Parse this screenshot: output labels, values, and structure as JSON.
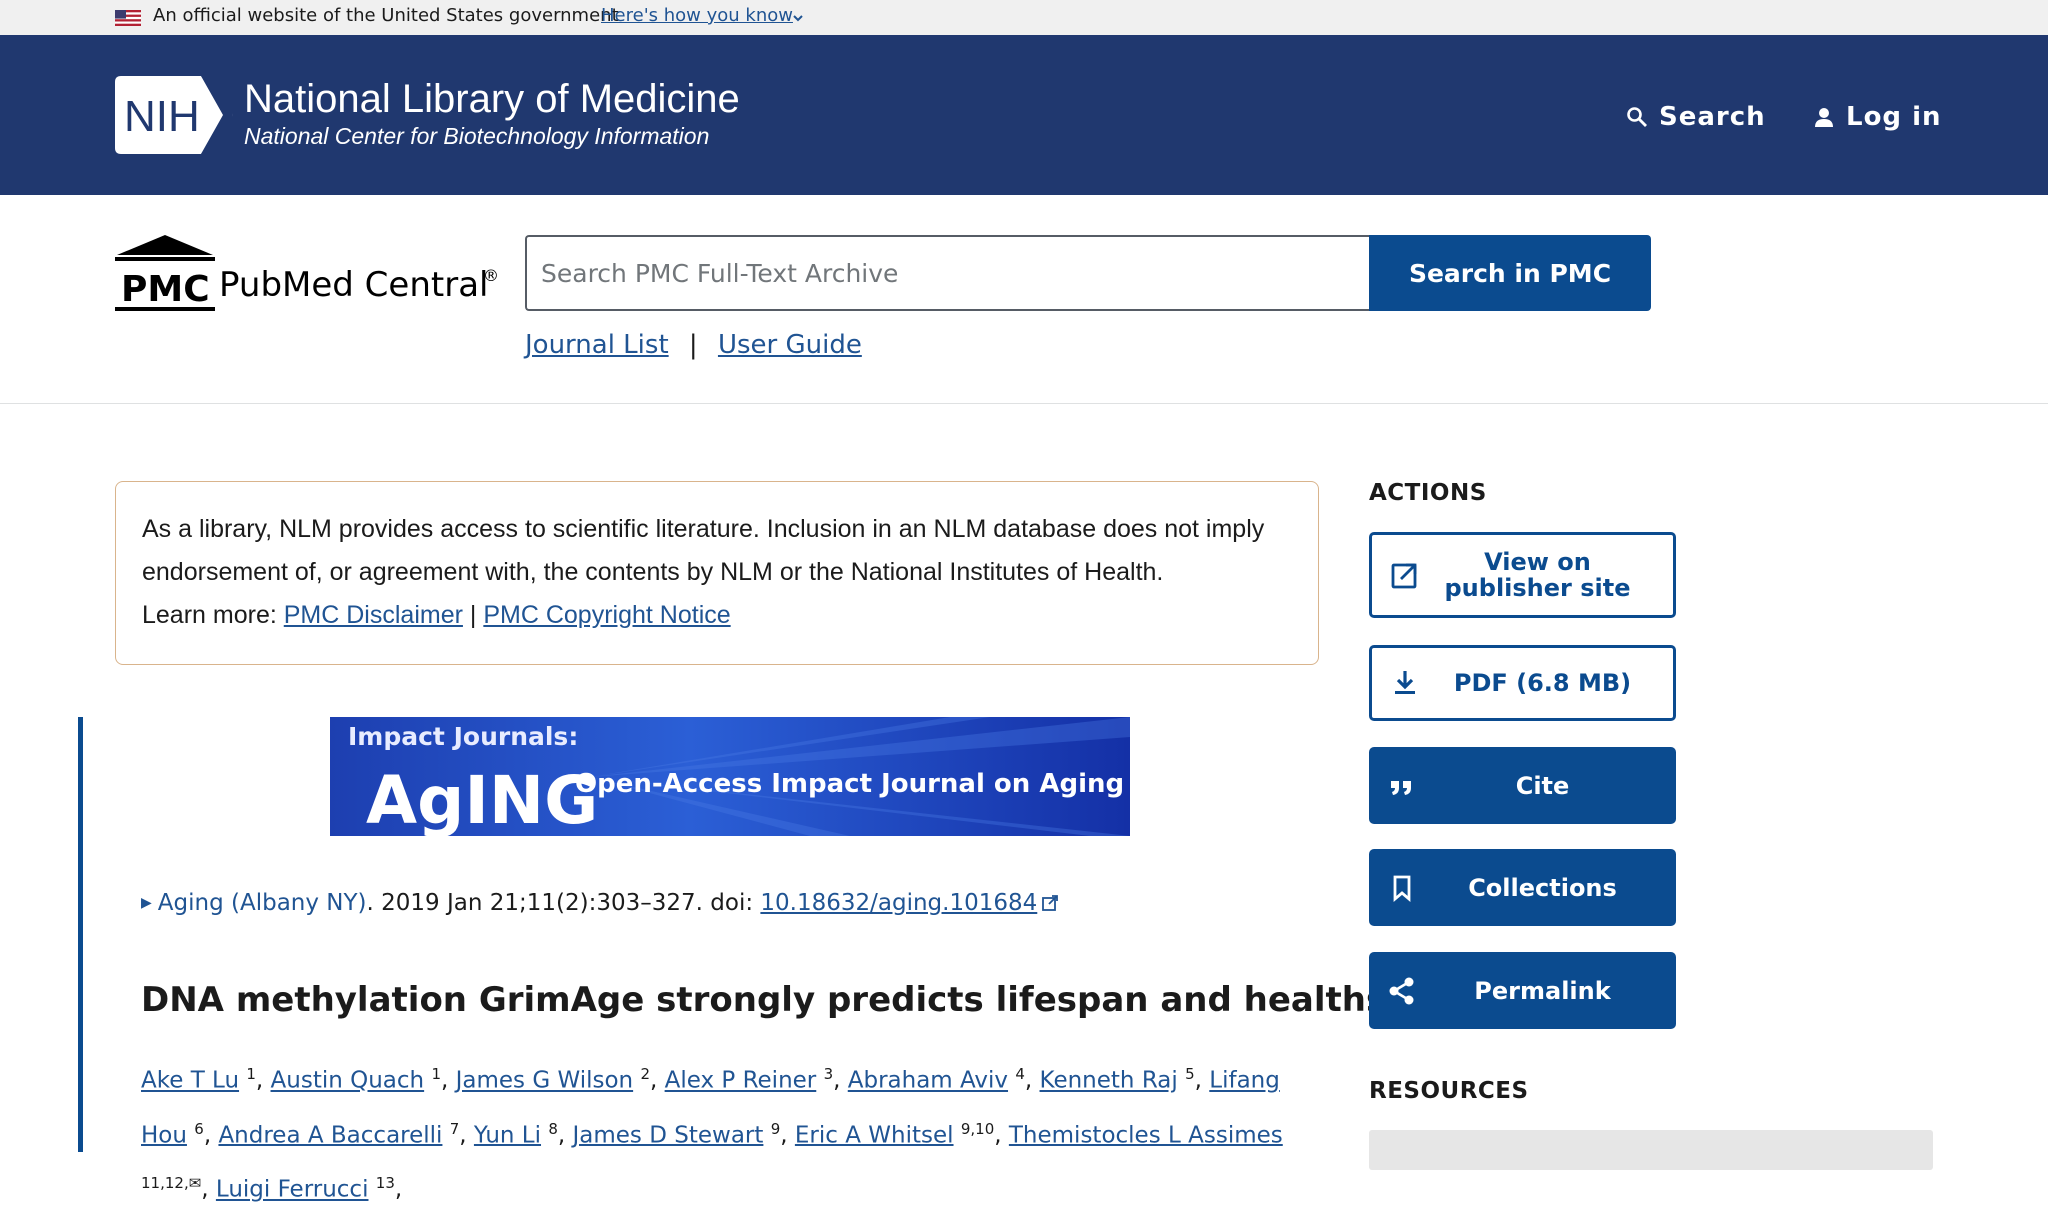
{
  "gov_banner": {
    "text": "An official website of the United States government",
    "link": "Here's how you know"
  },
  "header": {
    "logo_text": "NIH",
    "title": "National Library of Medicine",
    "subtitle": "National Center for Biotechnology Information",
    "search_label": "Search",
    "login_label": "Log in",
    "bg_color": "#20386f"
  },
  "pmc": {
    "logo_mark": "PMC",
    "logo_text": "PubMed Central",
    "logo_reg": "®",
    "search_placeholder": "Search PMC Full-Text Archive",
    "search_button": "Search in PMC",
    "links": [
      "Journal List",
      "User Guide"
    ],
    "link_separator": "|"
  },
  "disclaimer": {
    "text": "As a library, NLM provides access to scientific literature. Inclusion in an NLM database does not imply endorsement of, or agreement with, the contents by NLM or the National Institutes of Health.",
    "learn_more": "Learn more:",
    "link1": "PMC Disclaimer",
    "sep": "|",
    "link2": "PMC Copyright Notice"
  },
  "article": {
    "banner": {
      "publisher": "Impact Journals:",
      "journal_logo": "AgING",
      "tagline": "Open-Access Impact Journal on Aging"
    },
    "journal": "Aging (Albany NY)",
    "citation": ". 2019 Jan 21;11(2):303–327. doi: ",
    "doi": "10.18632/aging.101684",
    "title": "DNA methylation GrimAge strongly predicts lifespan and healthspan",
    "authors": [
      {
        "name": "Ake T Lu",
        "sup": "1"
      },
      {
        "name": "Austin Quach",
        "sup": "1"
      },
      {
        "name": "James G Wilson",
        "sup": "2"
      },
      {
        "name": "Alex P Reiner",
        "sup": "3"
      },
      {
        "name": "Abraham Aviv",
        "sup": "4"
      },
      {
        "name": "Kenneth Raj",
        "sup": "5"
      },
      {
        "name": "Lifang Hou",
        "sup": "6"
      },
      {
        "name": "Andrea A Baccarelli",
        "sup": "7"
      },
      {
        "name": "Yun Li",
        "sup": "8"
      },
      {
        "name": "James D Stewart",
        "sup": "9"
      },
      {
        "name": "Eric A Whitsel",
        "sup": "9,10"
      },
      {
        "name": "Themistocles L Assimes",
        "sup": "11,12,✉"
      },
      {
        "name": "Luigi Ferrucci",
        "sup": "13"
      }
    ]
  },
  "sidebar": {
    "actions_heading": "ACTIONS",
    "actions": [
      {
        "label": "View on publisher site",
        "icon": "external-link-icon",
        "style": "outline"
      },
      {
        "label": "PDF (6.8 MB)",
        "icon": "download-icon",
        "style": "outline"
      },
      {
        "label": "Cite",
        "icon": "quote-icon",
        "style": "filled"
      },
      {
        "label": "Collections",
        "icon": "bookmark-icon",
        "style": "filled"
      },
      {
        "label": "Permalink",
        "icon": "share-icon",
        "style": "filled"
      }
    ],
    "resources_heading": "RESOURCES",
    "accent_color": "#0b4b8f"
  }
}
